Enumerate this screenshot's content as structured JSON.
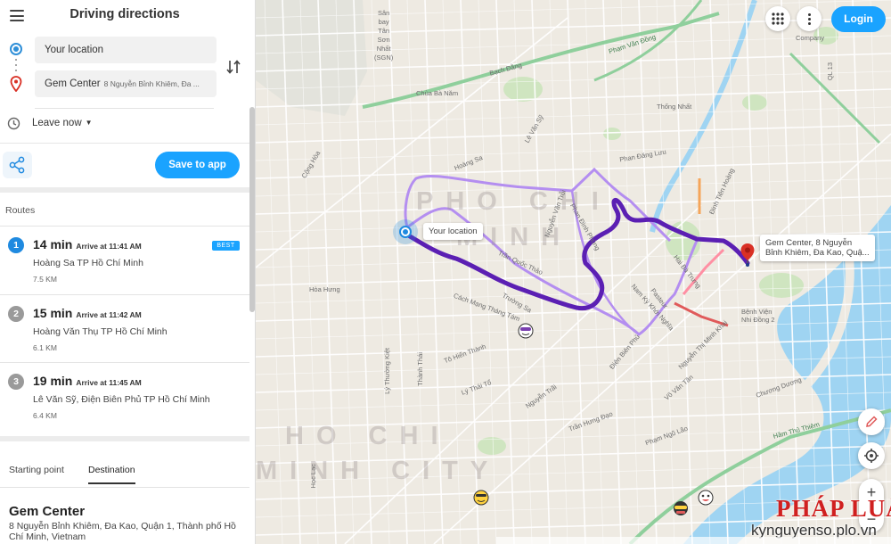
{
  "sidebar": {
    "title": "Driving directions",
    "from_value": "Your location",
    "to_name": "Gem Center",
    "to_address": "8 Nguyễn Bỉnh Khiêm, Đa ...",
    "leave_label": "Leave now",
    "save_label": "Save to app",
    "routes_heading": "Routes",
    "best_badge": "BEST",
    "routes": [
      {
        "num": "1",
        "duration": "14 min",
        "arrive": "Arrive at 11:41 AM",
        "via": "Hoàng Sa TP Hồ Chí Minh",
        "distance": "7.5 KM"
      },
      {
        "num": "2",
        "duration": "15 min",
        "arrive": "Arrive at 11:42 AM",
        "via": "Hoàng Văn Thụ TP Hồ Chí Minh",
        "distance": "6.1 KM"
      },
      {
        "num": "3",
        "duration": "19 min",
        "arrive": "Arrive at 11:45 AM",
        "via": "Lê Văn Sỹ, Điện Biên Phủ TP Hồ Chí Minh",
        "distance": "6.4 KM"
      }
    ],
    "tabs": {
      "start": "Starting point",
      "dest": "Destination"
    },
    "destination": {
      "name": "Gem Center",
      "address": "8 Nguyễn Bỉnh Khiêm, Đa Kao, Quận 1, Thành phố Hồ Chí Minh, Vietnam"
    }
  },
  "map": {
    "login_label": "Login",
    "origin_tag": "Your location",
    "dest_tag_line1": "Gem Center, 8 Nguyễn",
    "dest_tag_line2": "Bỉnh Khiêm, Đa Kao, Quậ...",
    "ghost_label_1": "PHO CHI",
    "ghost_label_2": "MINH",
    "ghost_label_3": "HO CHI",
    "ghost_label_4": "MINH CITY",
    "watermark_brand": "PHÁP LUẬT",
    "watermark_site": "kynguyenso.plo.vn",
    "colors": {
      "main_route": "#5b1fb3",
      "alt_route": "#b48ef0",
      "accent": "#1aa3ff",
      "pin": "#d93025"
    },
    "labels": {
      "airport": [
        "Sân",
        "bay",
        "Tân",
        "Sơn",
        "Nhất",
        "(SGN)"
      ],
      "pham_van_dong": "Phạm Văn Đồng",
      "company": "Company",
      "bach_dang": "Bạch Đằng",
      "phan_dang_luu": "Phan Đăng Lưu",
      "hoang_sa": "Hoàng Sa",
      "truong_sa": "Trường Sa",
      "pasteur": "Pasteur",
      "hai_ba_trung": "Hai Bà Trưng",
      "nguyen_thi_minh_khai": "Nguyễn Thị Minh Khai",
      "cach_mang_thang_tam": "Cách Mạng Tháng Tám",
      "to_hien_thanh": "Tô Hiến Thành",
      "ham_thu_thiem": "Hầm Thủ Thiêm",
      "pham_ngu_lao": "Phạm Ngũ Lão",
      "ly_thuong_kiet": "Lý Thường Kiệt",
      "dien_bien_phu": "Điện Biên Phủ",
      "cong_hoa": "Cộng Hòa",
      "benh_vien": "Bệnh Viện Nhi Đồng 2",
      "tran_hung_dao": "Trần Hưng Đạo",
      "thanh_thai": "Thành Thái",
      "vo_van_tan": "Võ Văn Tần",
      "nam_ky_khoi_nghia": "Nam Kỳ Khởi Nghĩa",
      "phan_dinh_phung": "Phan Đình Phùng",
      "thong_nhat": "Thống Nhất",
      "nguyen_van_troi": "Nguyễn Văn Trỗi",
      "dinh_tien_hoang": "Đinh Tiên Hoàng",
      "ql13": "QL 13",
      "chua_ba_nam": "Chùa Bà Năm",
      "le_van_sy": "Lê Văn Sỹ",
      "hoa_hung": "Hòa Hưng",
      "tran_quoc_thao": "Trần Quốc Thảo",
      "hoc_lac": "Học Lạc",
      "ly_thai_to": "Lý Thái Tổ",
      "chuong_duong": "Chương Dương",
      "nguyen_trai": "Nguyễn Trãi"
    }
  }
}
